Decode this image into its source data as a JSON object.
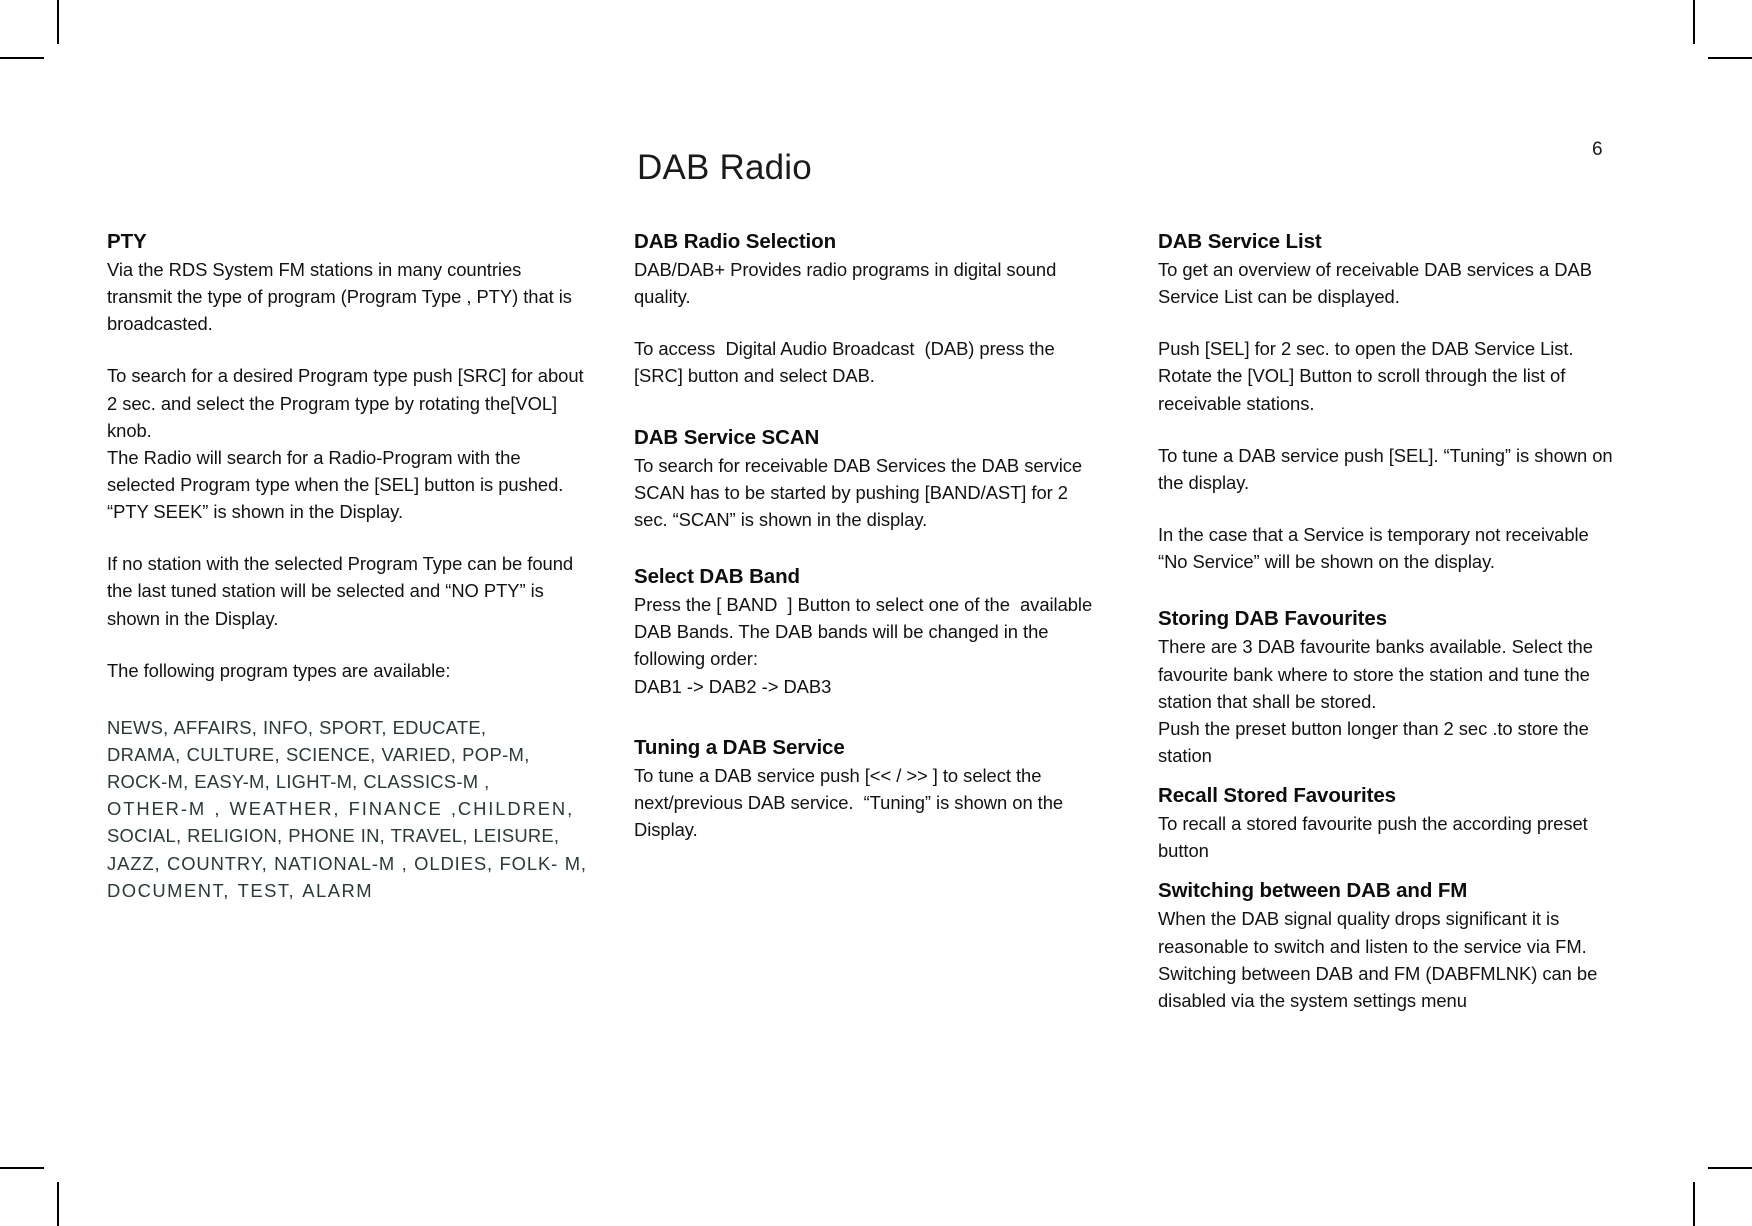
{
  "page": {
    "title": "DAB Radio",
    "number": "6"
  },
  "columns": [
    {
      "id": "column-1",
      "sections": [
        {
          "id": "pty",
          "heading": "PTY",
          "paragraphs": [
            "Via the RDS System FM stations in many countries transmit the type of program (Program Type , PTY) that is broadcasted.",
            "To search for a desired Program type push [SRC] for about 2 sec. and select the Program type by rotating the[VOL] knob.\nThe Radio will search for a Radio-Program with the selected Program type when the [SEL] button is pushed. “PTY SEEK” is shown in the Display.",
            "If no station with the selected Program Type can be found the last tuned station will be selected and “NO PTY” is shown in the Display.",
            "The following program types are available:"
          ],
          "program_type_lines": [
            "NEWS, AFFAIRS, INFO, SPORT, EDUCATE,",
            "DRAMA, CULTURE, SCIENCE, VARIED, POP-M,",
            "ROCK-M, EASY-M, LIGHT-M, CLASSICS-M ,",
            "OTHER-M ,  WEATHER,  FINANCE ,CHILDREN,",
            "SOCIAL, RELIGION, PHONE IN, TRAVEL, LEISURE,",
            "JAZZ, COUNTRY, NATIONAL-M ,  OLDIES,  FOLK- M,",
            "DOCUMENT,  TEST, ALARM"
          ]
        }
      ]
    },
    {
      "id": "column-2",
      "sections": [
        {
          "id": "dab-radio-selection",
          "heading": "DAB Radio Selection",
          "paragraphs": [
            "DAB/DAB+ Provides radio programs in digital sound quality.",
            "To access  Digital Audio Broadcast  (DAB) press the [SRC] button and select DAB."
          ]
        },
        {
          "id": "dab-service-scan",
          "heading": "DAB Service SCAN",
          "paragraphs": [
            "To search for receivable DAB Services the DAB service SCAN has to be started by pushing [BAND/AST] for 2 sec. “SCAN” is shown in the display."
          ]
        },
        {
          "id": "select-dab-band",
          "heading": "Select DAB Band",
          "paragraphs": [
            "Press the [ BAND  ] Button to select one of the  available DAB Bands. The DAB bands will be changed in the following order:\nDAB1 -> DAB2 -> DAB3"
          ]
        },
        {
          "id": "tuning-a-dab-service",
          "heading": "Tuning a DAB Service",
          "paragraphs": [
            "To tune a DAB service push [<< / >> ] to select the next/previous DAB service.  “Tuning” is shown on the Display."
          ]
        }
      ]
    },
    {
      "id": "column-3",
      "sections": [
        {
          "id": "dab-service-list",
          "heading": "DAB Service List",
          "paragraphs": [
            "To get an overview of receivable DAB services a DAB Service List can be displayed.",
            "Push [SEL] for 2 sec. to open the DAB Service List. Rotate the [VOL] Button to scroll through the list of receivable stations.",
            "To tune a DAB service push [SEL]. “Tuning” is shown on the display.",
            "In the case that a Service is temporary not receivable “No Service” will be shown on the display."
          ]
        },
        {
          "id": "storing-dab-favourites",
          "heading": "Storing DAB Favourites",
          "paragraphs": [
            "There are 3 DAB favourite banks available. Select the favourite bank where to store the station and tune the station that shall be stored.\nPush the preset button longer than 2 sec .to store the station"
          ]
        },
        {
          "id": "recall-stored-favourites",
          "heading": "Recall Stored Favourites",
          "paragraphs": [
            "To recall a stored favourite push the according preset button"
          ]
        },
        {
          "id": "switching-between-dab-and-fm",
          "heading": "Switching between DAB and FM",
          "paragraphs": [
            "When the DAB signal quality drops significant it is reasonable to switch and listen to the service via FM.\nSwitching between DAB and FM (DABFMLNK) can be disabled via the system settings menu"
          ]
        }
      ]
    }
  ]
}
